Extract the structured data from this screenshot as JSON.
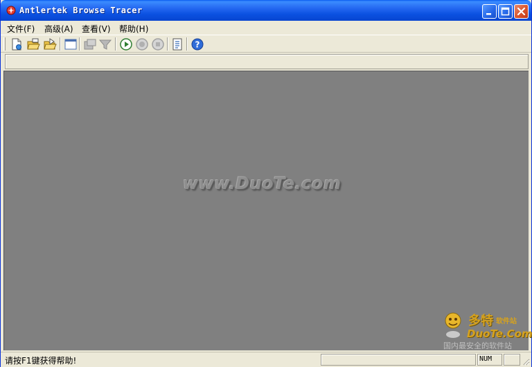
{
  "window": {
    "title": "Antlertek Browse Tracer"
  },
  "menu": {
    "items": [
      {
        "label": "文件(F)"
      },
      {
        "label": "高级(A)"
      },
      {
        "label": "查看(V)"
      },
      {
        "label": "帮助(H)"
      }
    ]
  },
  "toolbar": {
    "buttons": [
      {
        "icon": "new-file-icon"
      },
      {
        "icon": "open-folder-icon"
      },
      {
        "icon": "browse-folder-icon"
      },
      {
        "icon": "window-icon"
      },
      {
        "icon": "export-icon"
      },
      {
        "icon": "filter-icon"
      },
      {
        "icon": "play-icon"
      },
      {
        "icon": "pause-icon"
      },
      {
        "icon": "stop-icon"
      },
      {
        "icon": "report-icon"
      },
      {
        "icon": "help-icon"
      }
    ]
  },
  "client": {
    "watermark": "www.DuoTe.com"
  },
  "logo": {
    "cn_name": "多特",
    "cn_sub": "软件站",
    "en_name": "DuoTe.Com",
    "slogan": "国内最安全的软件站"
  },
  "status": {
    "message": "请按F1键获得帮助!",
    "num_indicator": "NUM"
  },
  "colors": {
    "titlebar": "#0A50E0",
    "client_bg": "#808080",
    "chrome_bg": "#ECE9D8",
    "close_button": "#D9542C"
  }
}
